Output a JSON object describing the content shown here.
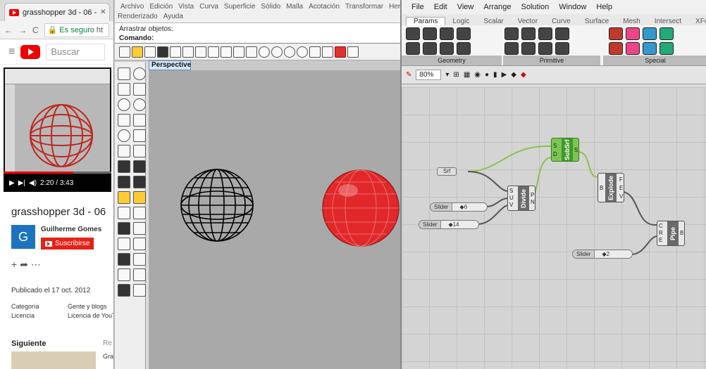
{
  "chrome": {
    "tab_title": "grasshopper 3d - 06 - ",
    "tab_close": "✕",
    "nav_back": "←",
    "nav_forward": "→",
    "nav_reload": "C",
    "secure_label": "Es seguro",
    "url_prefix": "ht",
    "search_placeholder": "Buscar",
    "video_time": "2:20 / 3:43",
    "video_progress": 0.65,
    "video_title": "grasshopper 3d - 06",
    "channel_initial": "G",
    "channel_name": "Guilherme Gomes",
    "subscribe_label": "Suscribirse",
    "published": "Publicado el 17 oct. 2012",
    "meta": [
      {
        "key": "Categoría",
        "value": "Gente y blogs"
      },
      {
        "key": "Licencia",
        "value": "Licencia de YouT"
      }
    ],
    "next_label": "Siguiente",
    "next_right": "Re",
    "thumb_title": "Gra"
  },
  "rhino": {
    "menu": [
      "Archivo",
      "Edición",
      "Vista",
      "Curva",
      "Superficie",
      "Sólido",
      "Malla",
      "Acotación",
      "Transformar",
      "Herramie"
    ],
    "menu2": [
      "Renderizado",
      "Ayuda"
    ],
    "cmd_line1": "Arrastrar objetos:",
    "cmd_line2": "Comando:",
    "viewport_label": "Perspective"
  },
  "grasshopper": {
    "menu": [
      "File",
      "Edit",
      "View",
      "Arrange",
      "Solution",
      "Window",
      "Help"
    ],
    "tabs": [
      "Params",
      "Logic",
      "Scalar",
      "Vector",
      "Curve",
      "Surface",
      "Mesh",
      "Intersect",
      "XForm",
      "Complex"
    ],
    "ribbon_groups": [
      "Geometry",
      "Primitive",
      "Special"
    ],
    "zoom": "80%",
    "nodes": {
      "srf_param": "Srf",
      "divide": "Divide",
      "subsrf": "SubSrf",
      "explode": "Explode",
      "pipe": "Pipe"
    },
    "sliders": [
      {
        "tag": "Slider",
        "value": "◆6"
      },
      {
        "tag": "Slider",
        "value": "◆14"
      },
      {
        "tag": "Slider",
        "value": "◆2"
      }
    ],
    "ports": {
      "divide_in": [
        "S",
        "U",
        "V"
      ],
      "divide_out": [
        "P",
        "N",
        "uv"
      ],
      "subsrf_in": [
        "S",
        "D"
      ],
      "subsrf_out": [
        "S"
      ],
      "explode_in": [
        "B"
      ],
      "explode_out": [
        "F",
        "E",
        "V"
      ],
      "pipe_in": [
        "C",
        "R",
        "E"
      ],
      "pipe_out": [
        "B"
      ]
    }
  },
  "colors": {
    "accent_red": "#e00",
    "gh_green": "#7ac653",
    "wire_green": "#8bc34a"
  }
}
